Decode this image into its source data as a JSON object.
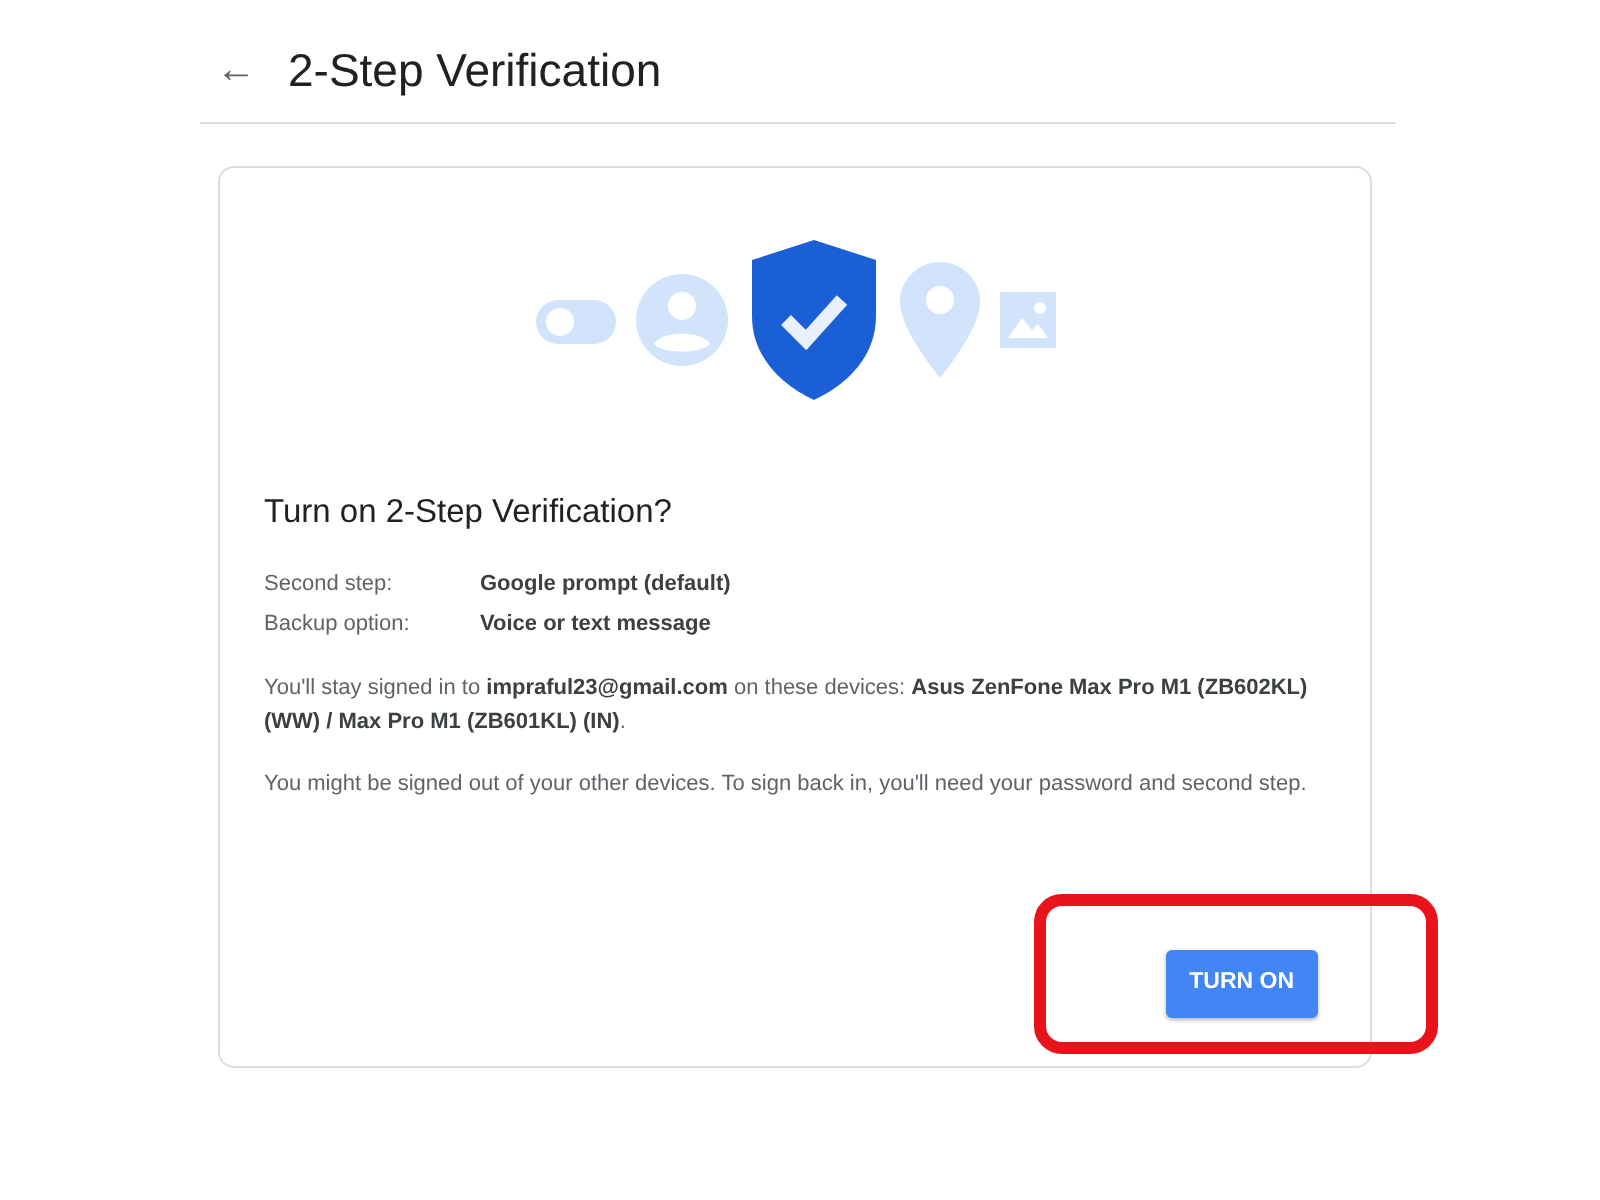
{
  "header": {
    "back_icon": "←",
    "title": "2-Step Verification"
  },
  "card": {
    "heading": "Turn on 2-Step Verification?",
    "details": [
      {
        "label": "Second step:",
        "value": "Google prompt (default)"
      },
      {
        "label": "Backup option:",
        "value": "Voice or text message"
      }
    ],
    "paragraphs": [
      "You'll stay signed in to **impraful23@gmail.com** on these devices: **Asus ZenFone Max Pro M1 (ZB602KL) (WW) / Max Pro M1 (ZB601KL) (IN)**.",
      "You might be signed out of your other devices. To sign back in, you'll need your password and second step."
    ],
    "button": {
      "label": "TURN ON",
      "highlighted": true
    }
  }
}
